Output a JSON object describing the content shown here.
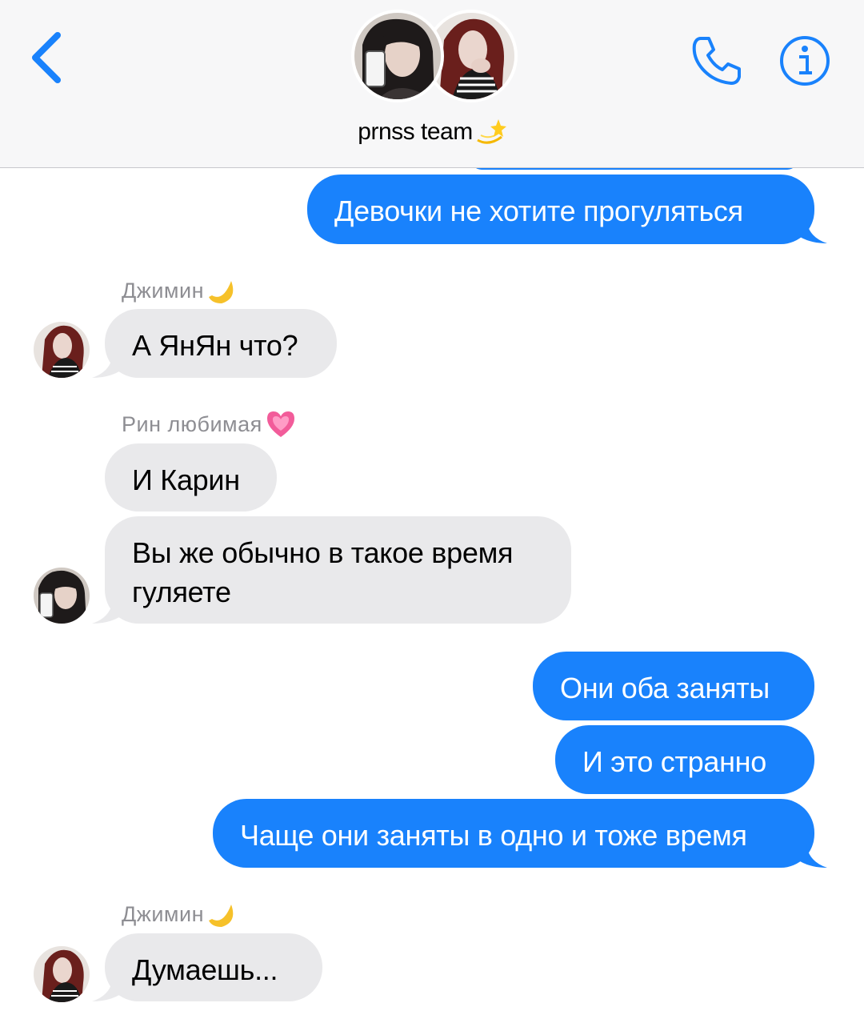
{
  "header": {
    "back_icon": "chevron-left-icon",
    "group_title": "prnss team",
    "group_title_emoji": "dizzy-star-emoji",
    "phone_icon": "phone-icon",
    "info_icon": "info-icon",
    "avatars": [
      "member-avatar-1",
      "member-avatar-2"
    ]
  },
  "colors": {
    "accent": "#1982fc",
    "incoming_bubble": "#e9e9eb",
    "sender_name": "#8e8e93",
    "header_bg": "#f7f7f8"
  },
  "messages": [
    {
      "direction": "outgoing",
      "text": "Девочки не хотите прогуляться"
    },
    {
      "direction": "incoming",
      "sender": "Джимин",
      "sender_emoji": "crescent-moon-emoji",
      "text": "А ЯнЯн что?"
    },
    {
      "direction": "incoming",
      "sender": "Рин любимая",
      "sender_emoji": "growing-heart-emoji",
      "text": "И Карин"
    },
    {
      "direction": "incoming",
      "text_line1": "Вы же обычно в такое время",
      "text_line2": "гуляете"
    },
    {
      "direction": "outgoing",
      "text": "Они оба заняты"
    },
    {
      "direction": "outgoing",
      "text": "И это странно"
    },
    {
      "direction": "outgoing",
      "text": "Чаще они заняты в одно и тоже время"
    },
    {
      "direction": "incoming",
      "sender": "Джимин",
      "sender_emoji": "crescent-moon-emoji",
      "text": "Думаешь..."
    }
  ]
}
